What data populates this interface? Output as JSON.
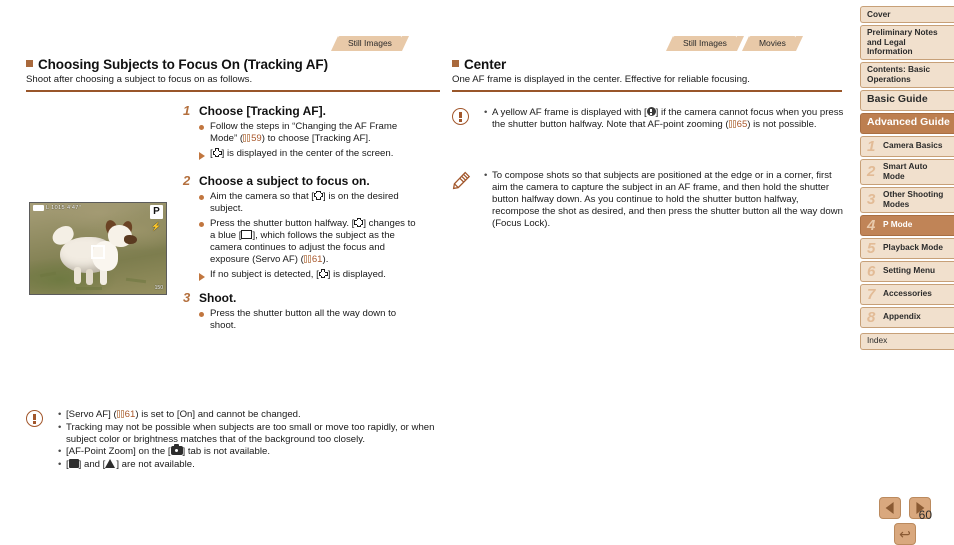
{
  "page": {
    "number": "60"
  },
  "left_column": {
    "tab_label": "Still Images",
    "heading": "Choosing Subjects to Focus On (Tracking AF)",
    "subheading": "Shoot after choosing a subject to focus on as follows.",
    "steps": [
      {
        "number": "1",
        "title": "Choose [Tracking AF].",
        "bullets": [
          {
            "marker": "dot",
            "text_parts": [
              {
                "t": "Follow the steps in “Changing the AF Frame Mode” ("
              },
              {
                "ref": "59"
              },
              {
                "t": ") to choose [Tracking AF]."
              }
            ]
          },
          {
            "marker": "triangle",
            "text_parts": [
              {
                "t": "["
              },
              {
                "icon": "af-frame-icon"
              },
              {
                "t": "] is displayed in the center of the screen."
              }
            ]
          }
        ]
      },
      {
        "number": "2",
        "title": "Choose a subject to focus on.",
        "bullets": [
          {
            "marker": "dot",
            "text_parts": [
              {
                "t": "Aim the camera so that ["
              },
              {
                "icon": "af-frame-icon"
              },
              {
                "t": "] is on the desired subject."
              }
            ]
          },
          {
            "marker": "dot",
            "text_parts": [
              {
                "t": "Press the shutter button halfway. ["
              },
              {
                "icon": "af-frame-icon"
              },
              {
                "t": "] changes to a blue ["
              },
              {
                "icon": "blue-frame-icon"
              },
              {
                "t": "], which follows the subject as the camera continues to adjust the focus and exposure (Servo AF) ("
              },
              {
                "ref": "61"
              },
              {
                "t": ")."
              }
            ]
          },
          {
            "marker": "triangle",
            "text_parts": [
              {
                "t": "If no subject is detected, ["
              },
              {
                "icon": "af-frame-icon"
              },
              {
                "t": "] is displayed."
              }
            ]
          }
        ]
      },
      {
        "number": "3",
        "title": "Shoot.",
        "bullets": [
          {
            "marker": "dot",
            "text_parts": [
              {
                "t": "Press the shutter button all the way down to shoot."
              }
            ]
          }
        ]
      }
    ],
    "caution": {
      "icon": "warning-icon",
      "items": [
        [
          {
            "t": "[Servo AF] ("
          },
          {
            "ref": "61"
          },
          {
            "t": ") is set to [On] and cannot be changed."
          }
        ],
        [
          {
            "t": "Tracking may not be possible when subjects are too small or move too rapidly, or when subject color or brightness matches that of the background too closely."
          }
        ],
        [
          {
            "t": "[AF-Point Zoom] on the ["
          },
          {
            "icon": "camera-tab-icon"
          },
          {
            "t": "] tab is not available."
          }
        ],
        [
          {
            "t": "["
          },
          {
            "icon": "macro-icon"
          },
          {
            "t": "] and ["
          },
          {
            "icon": "infinity-icon"
          },
          {
            "t": "] are not available."
          }
        ]
      ]
    },
    "screen_image": {
      "name": "camera-screen-sample",
      "osd_top_text": "L   1015        4ʹ47ʺ",
      "mode_badge": "P",
      "flash_glyph": "⚡",
      "iso_label": "150"
    }
  },
  "right_column": {
    "tabs": [
      "Still Images",
      "Movies"
    ],
    "heading": "Center",
    "subheading": "One AF frame is displayed in the center. Effective for reliable focusing.",
    "caution": {
      "icon": "warning-icon",
      "items": [
        [
          {
            "t": "A yellow AF frame is displayed with ["
          },
          {
            "icon": "exclamation-dot-icon"
          },
          {
            "t": "] if the camera cannot focus when you press the shutter button halfway. Note that AF-point zooming ("
          },
          {
            "ref": "65"
          },
          {
            "t": ") is not possible."
          }
        ]
      ]
    },
    "note": {
      "icon": "pencil-icon",
      "items": [
        [
          {
            "t": "To compose shots so that subjects are positioned at the edge or in a corner, first aim the camera to capture the subject in an AF frame, and then hold the shutter button halfway down. As you continue to hold the shutter button halfway, recompose the shot as desired, and then press the shutter button all the way down (Focus Lock)."
          }
        ]
      ]
    }
  },
  "sidebar": {
    "items": [
      {
        "label": "Cover",
        "num": null,
        "style": "plain"
      },
      {
        "label": "Preliminary Notes and Legal Information",
        "num": null,
        "style": "tall"
      },
      {
        "label": "Contents: Basic Operations",
        "num": null,
        "style": "tall"
      },
      {
        "label": "Basic Guide",
        "num": null,
        "style": "big"
      },
      {
        "label": "Advanced Guide",
        "num": null,
        "style": "highlight"
      },
      {
        "label": "Camera Basics",
        "num": "1",
        "style": "numbered"
      },
      {
        "label": "Smart Auto Mode",
        "num": "2",
        "style": "numbered-tall"
      },
      {
        "label": "Other Shooting Modes",
        "num": "3",
        "style": "numbered-tall"
      },
      {
        "label": "P Mode",
        "num": "4",
        "style": "numbered-active"
      },
      {
        "label": "Playback Mode",
        "num": "5",
        "style": "numbered"
      },
      {
        "label": "Setting Menu",
        "num": "6",
        "style": "numbered"
      },
      {
        "label": "Accessories",
        "num": "7",
        "style": "numbered"
      },
      {
        "label": "Appendix",
        "num": "8",
        "style": "numbered"
      },
      {
        "label": "Index",
        "num": null,
        "style": "plain"
      }
    ]
  },
  "nav_buttons": {
    "previous": "previous-page-button",
    "next": "next-page-button",
    "back": "back-button",
    "back_glyph": "↩"
  },
  "colors": {
    "accent_brown": "#a9693c",
    "rule_brown": "#99562a",
    "tab_beige": "#e8c9a8",
    "sidebar_bg": "#f1e0cd",
    "sidebar_active": "#c08457",
    "link_brown": "#a9572b"
  }
}
